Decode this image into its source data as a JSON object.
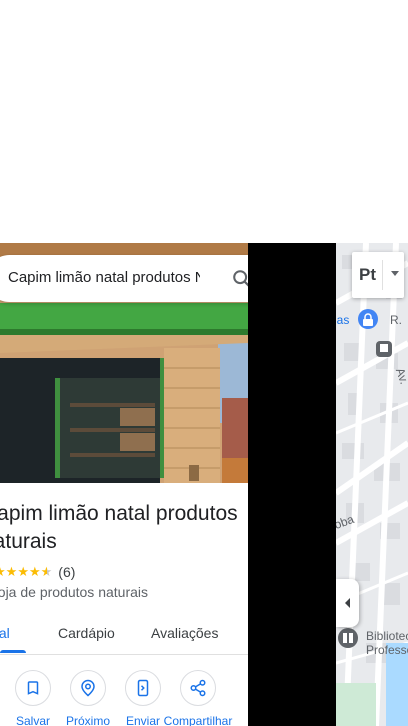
{
  "search": {
    "query": "Capim limão natal produtos Na"
  },
  "place": {
    "title": "Capim limão natal produtos naturais",
    "rating": 4.5,
    "rating_count": "(6)",
    "category": "Loja de produtos naturais"
  },
  "tabs": [
    {
      "label": "Visão geral",
      "active": true
    },
    {
      "label": "Cardápio",
      "active": false
    },
    {
      "label": "Avaliações",
      "active": false
    }
  ],
  "actions": [
    {
      "label": "Salvar",
      "icon": "bookmark-icon"
    },
    {
      "label": "Próximo",
      "icon": "nearby-icon"
    },
    {
      "label": "Enviar",
      "icon": "send-to-phone-icon"
    },
    {
      "label": "Compartilhar",
      "icon": "share-icon"
    }
  ],
  "map": {
    "language_button": "Pt",
    "labels": {
      "las": "las",
      "r": "R.",
      "av": "Av.",
      "oba": "oba",
      "library": "Biblioteca Professora"
    }
  },
  "colors": {
    "accent": "#1a73e8",
    "star": "#fbbc04",
    "map_bg": "#e8eaed",
    "road": "#ffffff",
    "water": "#aadaff"
  }
}
